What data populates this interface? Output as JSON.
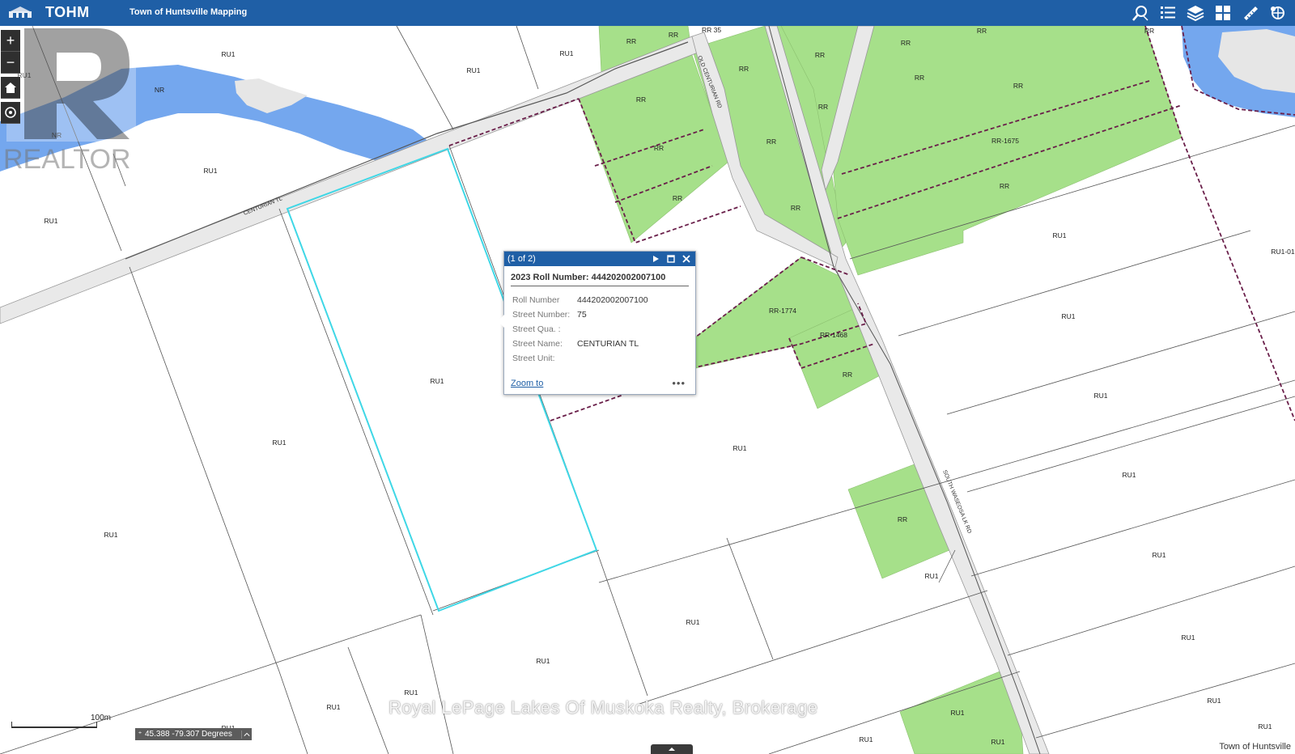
{
  "app": {
    "title": "TOHM",
    "subtitle": "Town of Huntsville Mapping"
  },
  "toolbar": {
    "tools": [
      {
        "icon": "search-icon"
      },
      {
        "icon": "list-icon"
      },
      {
        "icon": "layers-icon"
      },
      {
        "icon": "grid-icon"
      },
      {
        "icon": "ruler-icon"
      },
      {
        "icon": "extract-icon"
      }
    ]
  },
  "watermark": {
    "logo_text": "REALTOR",
    "brokerage": "Royal LePage Lakes Of Muskoka Realty, Brokerage"
  },
  "popup": {
    "count": "(1 of 2)",
    "title": "2023 Roll Number: 444202002007100",
    "attributes": [
      {
        "label": "Roll Number",
        "value": "444202002007100"
      },
      {
        "label": "Street Number:",
        "value": "75"
      },
      {
        "label": "Street Qua. :",
        "value": ""
      },
      {
        "label": "Street Name:",
        "value": "CENTURIAN TL"
      },
      {
        "label": "Street Unit:",
        "value": ""
      }
    ],
    "zoom_to": "Zoom to",
    "more": "•••"
  },
  "map": {
    "roads": [
      "CENTURIAN TL",
      "OLD CENTURIAN RD",
      "SOUTH WASEOSA LK RD"
    ],
    "zone_labels": [
      "RU1",
      "RR",
      "NR",
      "RR-1675",
      "RR-1774",
      "RR-1468",
      "RU1-01",
      "RR 35"
    ]
  },
  "scale": {
    "label": "100m"
  },
  "coords": {
    "value": "45.388 -79.307 Degrees"
  },
  "attribution": "Town of Huntsville",
  "colors": {
    "header": "#1f5fa6",
    "zone_green": "#a6e08a",
    "water": "#74a7ee",
    "selection": "#3fd7e6"
  }
}
